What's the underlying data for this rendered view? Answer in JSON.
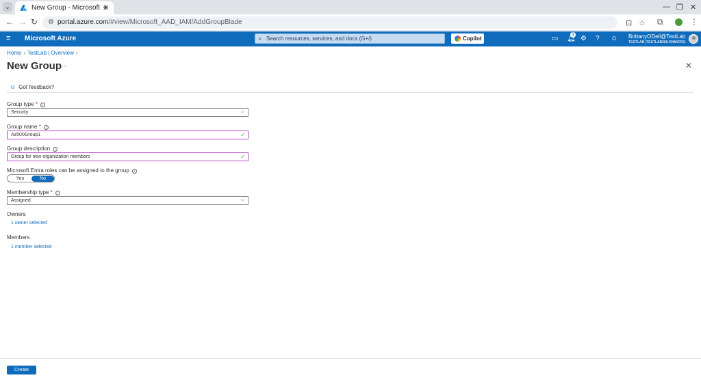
{
  "browser": {
    "tab_title": "New Group - Microsoft A",
    "url_host": "portal.azure.com",
    "url_path": "/#view/Microsoft_AAD_IAM/AddGroupBlade"
  },
  "azure": {
    "brand": "Microsoft Azure",
    "search_placeholder": "Search resources, services, and docs (G+/)",
    "copilot_label": "Copilot",
    "notification_count": "1",
    "account_name": "BrittanyODell@TestLab...",
    "account_tenant": "TESTLAB (TESTLAB280.ONMICRO..."
  },
  "breadcrumb": {
    "items": [
      "Home",
      "TestLab | Overview"
    ]
  },
  "page": {
    "title": "New Group",
    "more": "...",
    "feedback_label": "Got feedback?"
  },
  "form": {
    "group_type": {
      "label": "Group type",
      "required": "*",
      "value": "Security"
    },
    "group_name": {
      "label": "Group name",
      "required": "*",
      "value": "Az500Group1"
    },
    "group_description": {
      "label": "Group description",
      "value": "Group for new organization members"
    },
    "entra_roles": {
      "label": "Microsoft Entra roles can be assigned to the group",
      "yes": "Yes",
      "no": "No",
      "selected": "No"
    },
    "membership_type": {
      "label": "Membership type",
      "required": "*",
      "value": "Assigned"
    },
    "owners": {
      "label": "Owners",
      "link": "1 owner selected"
    },
    "members": {
      "label": "Members",
      "link": "1 member selected"
    }
  },
  "footer": {
    "create_label": "Create"
  },
  "colors": {
    "azure_blue": "#0f6cbd",
    "focus_border": "#b146c2",
    "valid_check": "#3a9e47",
    "required": "#a4262c"
  },
  "icons": {
    "hamburger": "hamburger-menu-icon",
    "search": "search-icon",
    "cloud_shell": "cloud-shell-icon",
    "notifications": "bell-icon",
    "settings": "gear-icon",
    "help": "help-icon",
    "feedback": "feedback-icon"
  }
}
